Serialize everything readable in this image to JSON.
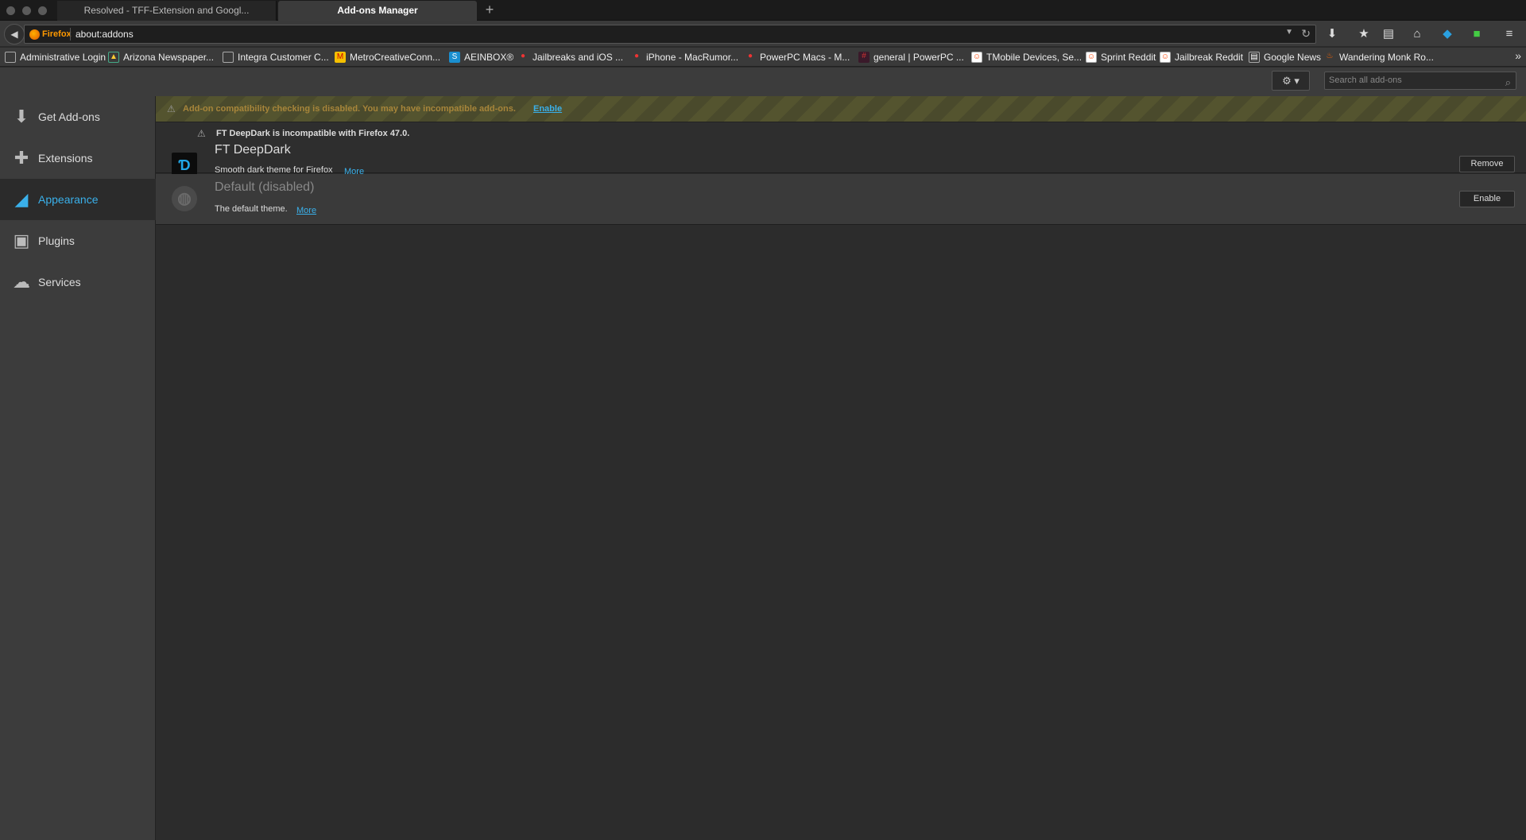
{
  "tabs": [
    {
      "label": "Resolved - TFF-Extension and Googl..."
    },
    {
      "label": "Add-ons Manager"
    }
  ],
  "navbar": {
    "identity_label": "Firefox",
    "url": "about:addons"
  },
  "bookmarks": [
    {
      "label": "Administrative Login"
    },
    {
      "label": "Arizona Newspaper..."
    },
    {
      "label": "Integra Customer C..."
    },
    {
      "label": "MetroCreativeConn..."
    },
    {
      "label": "AEINBOX®"
    },
    {
      "label": "Jailbreaks and iOS ..."
    },
    {
      "label": "iPhone - MacRumor..."
    },
    {
      "label": "PowerPC Macs - M..."
    },
    {
      "label": "general | PowerPC ..."
    },
    {
      "label": "TMobile Devices, Se..."
    },
    {
      "label": "Sprint Reddit"
    },
    {
      "label": "Jailbreak Reddit"
    },
    {
      "label": "Google News"
    },
    {
      "label": "Wandering Monk Ro..."
    }
  ],
  "search": {
    "placeholder": "Search all add-ons"
  },
  "sidebar": {
    "items": [
      {
        "label": "Get Add-ons",
        "icon": "download-icon"
      },
      {
        "label": "Extensions",
        "icon": "puzzle-icon"
      },
      {
        "label": "Appearance",
        "icon": "paintbrush-icon",
        "selected": true
      },
      {
        "label": "Plugins",
        "icon": "plugin-icon"
      },
      {
        "label": "Services",
        "icon": "chat-icon"
      }
    ]
  },
  "warning": {
    "text": "Add-on compatibility checking is disabled. You may have incompatible add-ons.",
    "link": "Enable"
  },
  "addons": [
    {
      "notice": "FT DeepDark is incompatible with Firefox 47.0.",
      "name": "FT DeepDark",
      "description": "Smooth dark theme for Firefox",
      "more": "More",
      "action": "Remove"
    },
    {
      "name": "Default  (disabled)",
      "description": "The default theme.",
      "more": "More",
      "action": "Enable"
    }
  ],
  "colors": {
    "accent": "#3ab0ea",
    "warning_text": "#a7853a"
  }
}
